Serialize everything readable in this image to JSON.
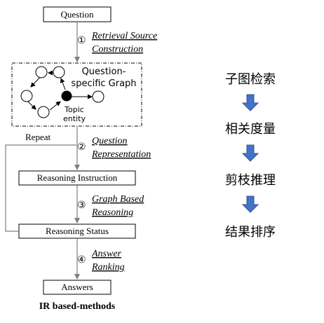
{
  "flow": {
    "question_box": "Question",
    "step1": {
      "num": "①",
      "line1": "Retrieval Source",
      "line2": "Construction"
    },
    "graph_caption_line1": "Question-",
    "graph_caption_line2": "specific Graph",
    "topic_line1": "Topic",
    "topic_line2": "entity",
    "repeat_label": "Repeat",
    "step2": {
      "num": "②",
      "line1": "Question",
      "line2": "Representation"
    },
    "reasoning_instruction_box": "Reasoning Instruction",
    "step3": {
      "num": "③",
      "line1": "Graph Based",
      "line2": "Reasoning"
    },
    "reasoning_status_box": "Reasoning Status",
    "step4": {
      "num": "④",
      "line1": "Answer",
      "line2": "Ranking"
    },
    "answers_box": "Answers",
    "footer_title": "IR based-methods"
  },
  "side_steps": [
    "子图检索",
    "相关度量",
    "剪枝推理",
    "结果排序"
  ],
  "colors": {
    "stroke": "#000000",
    "arrow_gray": "#7f7f7f",
    "side_arrow_fill": "#4472c4",
    "side_arrow_stroke": "#2f5597"
  }
}
